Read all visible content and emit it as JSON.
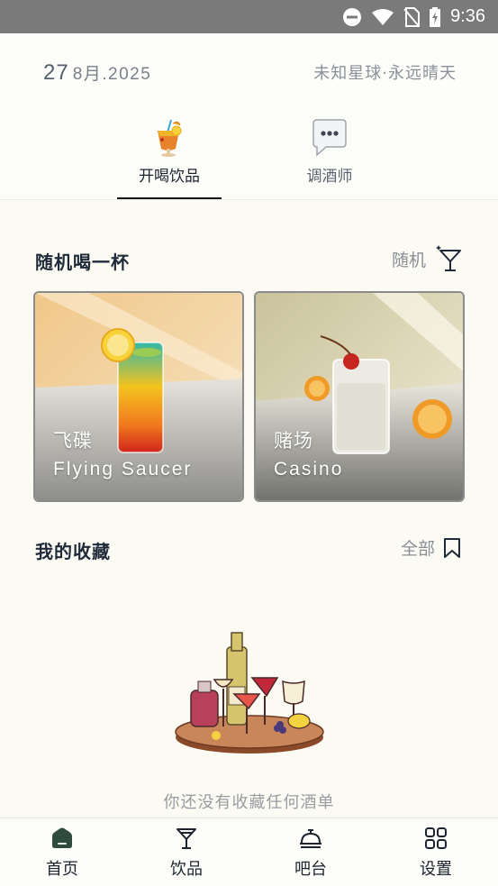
{
  "status_bar": {
    "time": "9:36"
  },
  "header": {
    "date_day": "27",
    "date_month_year": "8月.2025",
    "weather": "未知星球·永远晴天"
  },
  "tabs": [
    {
      "label": "开喝饮品",
      "icon": "tropical-drink-icon",
      "active": true
    },
    {
      "label": "调酒师",
      "icon": "speech-bubble-icon",
      "active": false
    }
  ],
  "random_section": {
    "title": "随机喝一杯",
    "action_label": "随机",
    "action_icon": "sparkle-cocktail-icon"
  },
  "drinks": [
    {
      "name_cn": "飞碟",
      "name_en": "Flying Saucer"
    },
    {
      "name_cn": "赌场",
      "name_en": "Casino"
    }
  ],
  "favorites_section": {
    "title": "我的收藏",
    "action_label": "全部",
    "action_icon": "bookmark-icon",
    "empty_text": "你还没有收藏任何酒单"
  },
  "bottom_nav": [
    {
      "label": "首页",
      "icon": "home-icon",
      "active": true
    },
    {
      "label": "饮品",
      "icon": "cocktail-glass-icon",
      "active": false
    },
    {
      "label": "吧台",
      "icon": "service-bell-icon",
      "active": false
    },
    {
      "label": "设置",
      "icon": "grid-icon",
      "active": false
    }
  ],
  "colors": {
    "background": "#fbfaf3",
    "status_bar": "#7a7a7a",
    "home_accent": "#2f4a3e",
    "text_primary": "#1f2a3a",
    "text_muted": "#8a8f97"
  }
}
